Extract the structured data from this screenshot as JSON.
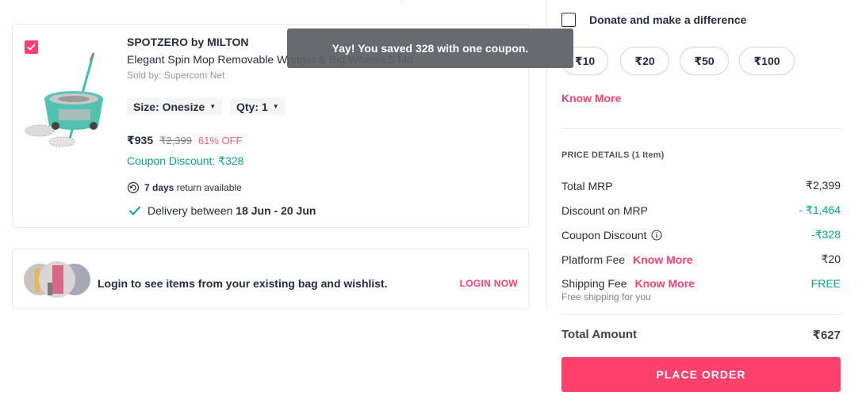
{
  "cart_item": {
    "brand": "SPOTZERO by MILTON",
    "title": "Elegant Spin Mop Removable Wringer & Big Wheels 5 Mop",
    "seller": "Sold by: Supercom Net",
    "size_label": "Size: Onesize",
    "qty_label": "Qty: 1",
    "selling_price": "₹935",
    "mrp": "₹2,399",
    "discount_percent": "61% OFF",
    "coupon_discount": "Coupon Discount: ₹328",
    "return_days": "7 days",
    "return_text": "return available",
    "delivery_prefix": "Delivery between",
    "delivery_dates": "18 Jun - 20 Jun",
    "selected": true
  },
  "login_banner": {
    "text": "Login to see items from your existing bag and wishlist.",
    "action": "LOGIN NOW"
  },
  "donation": {
    "label": "Donate and make a difference",
    "amounts": [
      "₹10",
      "₹20",
      "₹50",
      "₹100"
    ],
    "know_more": "Know More"
  },
  "price_details": {
    "title": "PRICE DETAILS (1 Item)",
    "rows": [
      {
        "label": "Total MRP",
        "value": "₹2,399"
      },
      {
        "label": "Discount on MRP",
        "value": "- ₹1,464"
      },
      {
        "label": "Coupon Discount",
        "value": "-₹328"
      },
      {
        "label": "Platform Fee",
        "link": "Know More",
        "value": "₹20"
      },
      {
        "label": "Shipping Fee",
        "link": "Know More",
        "value": "FREE"
      }
    ],
    "shipping_note": "Free shipping for you",
    "total_label": "Total Amount",
    "total_value": "₹627"
  },
  "place_order_label": "PLACE ORDER",
  "toast": {
    "message": "Yay! You saved 328 with one coupon."
  },
  "colors": {
    "accent": "#ff3f6c",
    "green": "#03a685",
    "discount_red": "#f16565"
  }
}
